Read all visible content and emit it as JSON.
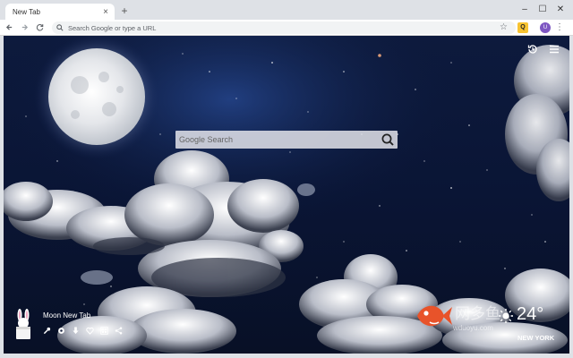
{
  "browser": {
    "tab_title": "New Tab",
    "tab_close": "×",
    "new_tab": "+",
    "omnibox_placeholder": "Search Google or type a URL",
    "extension_badge": "Q",
    "profile_initial": "U",
    "window_controls": [
      "–",
      "☐",
      "✕"
    ]
  },
  "page": {
    "search_placeholder": "Google Search",
    "app_name": "Moon New Tab",
    "tools": [
      "wrench-icon",
      "settings-icon",
      "download-icon",
      "heart-icon",
      "apps-icon",
      "share-icon"
    ],
    "weather": {
      "temperature": "24°",
      "city": "NEW YORK",
      "condition_icon": "sun-icon"
    },
    "watermark": {
      "text": "网多鱼",
      "url": "wduoyu.com"
    }
  }
}
